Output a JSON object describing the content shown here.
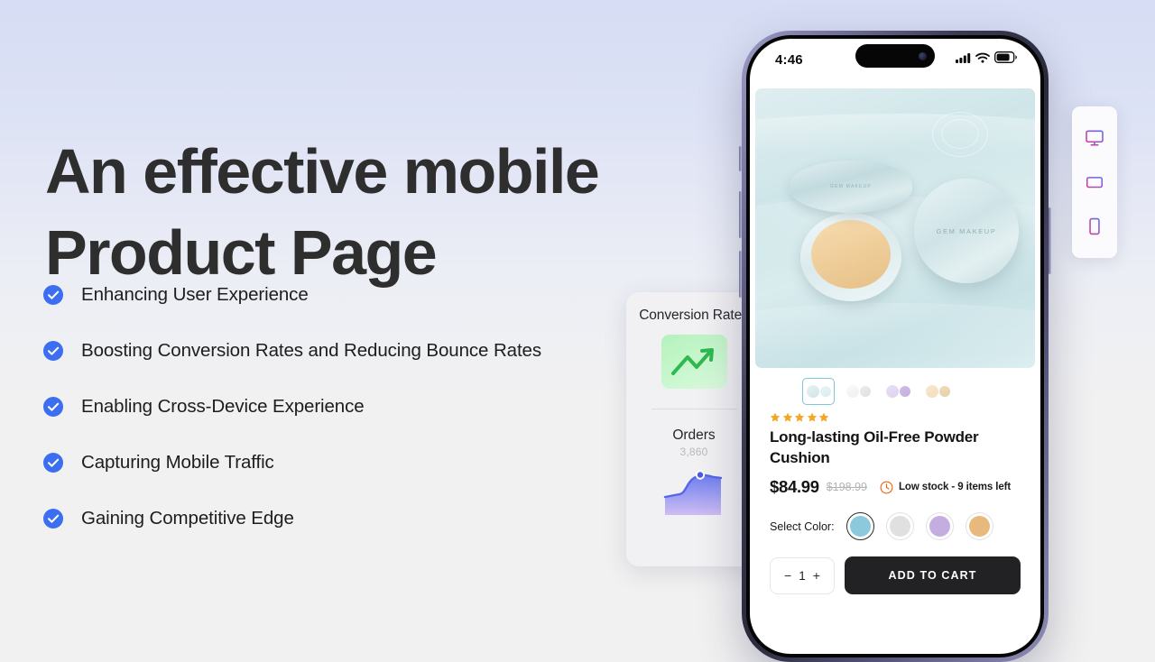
{
  "background": {
    "top_color": "#d6ddf4",
    "bottom_color": "#f1f1f1"
  },
  "hero": {
    "headline_line1": "An effective mobile",
    "headline_line2": "Product Page",
    "bullets": [
      {
        "label": "Enhancing User Experience"
      },
      {
        "label": "Boosting Conversion Rates and Reducing Bounce Rates"
      },
      {
        "label": "Enabling Cross-Device Experience"
      },
      {
        "label": "Capturing Mobile Traffic"
      },
      {
        "label": "Gaining Competitive Edge"
      }
    ],
    "check_icon": "check-circle-icon",
    "check_color": "#3b6ef0"
  },
  "analytics": {
    "conversion_title": "Conversion Rates",
    "conversion_icon": "trending-up-icon",
    "conversion_color": "#2fb94f",
    "orders_title": "Orders",
    "orders_value": "3,860",
    "orders_chart_color": "#6f7ff0"
  },
  "chart_data": [
    {
      "type": "line",
      "title": "Conversion Rates",
      "x": [
        0,
        1,
        2,
        3
      ],
      "values": [
        10,
        58,
        30,
        88
      ],
      "xlabel": "",
      "ylabel": "",
      "ylim": [
        0,
        100
      ],
      "grid": false,
      "legend": "none",
      "annotations": [
        "upward trending arrow"
      ]
    },
    {
      "type": "area",
      "title": "Orders",
      "value_label": "3,860",
      "x": [
        0,
        1,
        2,
        3,
        4,
        5,
        6,
        7
      ],
      "values": [
        30,
        34,
        36,
        38,
        56,
        74,
        78,
        70
      ],
      "xlabel": "",
      "ylabel": "",
      "ylim": [
        0,
        100
      ],
      "grid": false,
      "legend": "none",
      "marker_point": {
        "x": 6,
        "y": 78
      }
    }
  ],
  "phone": {
    "statusbar": {
      "time": "4:46",
      "signal_icon": "cellular-signal-icon",
      "wifi_icon": "wifi-icon",
      "battery_icon": "battery-icon"
    },
    "gallery": {
      "hero_alt": "GEM MAKEUP powder cushion compact on water",
      "lid_text": "GEM MAKEUP",
      "thumbnails": [
        {
          "name": "thumbnail-teal",
          "selected": true,
          "compact": "#cfe4e7",
          "lid": "#d8ecef"
        },
        {
          "name": "thumbnail-white",
          "selected": false,
          "compact": "#efefef",
          "lid": "#e0e0e0"
        },
        {
          "name": "thumbnail-lavender",
          "selected": false,
          "compact": "#ded2ef",
          "lid": "#c4aee0"
        },
        {
          "name": "thumbnail-tan",
          "selected": false,
          "compact": "#f2dcbc",
          "lid": "#e8cfa4"
        }
      ]
    },
    "product": {
      "rating_stars": 5,
      "star_color": "#f5a623",
      "title": "Long-lasting Oil-Free Powder Cushion",
      "price": "$84.99",
      "price_compare": "$198.99",
      "stock_icon": "clock-icon",
      "stock_color": "#f2600c",
      "stock_text": "Low stock - 9 items left",
      "color_label": "Select Color:",
      "colors": [
        {
          "name": "swatch-teal",
          "hex": "#8cc9dc",
          "selected": true
        },
        {
          "name": "swatch-white",
          "hex": "#e0e0e0",
          "selected": false
        },
        {
          "name": "swatch-lavender",
          "hex": "#c4aee0",
          "selected": false
        },
        {
          "name": "swatch-tan",
          "hex": "#e8b97d",
          "selected": false
        }
      ],
      "quantity": "1",
      "decrement_label": "−",
      "increment_label": "+",
      "add_to_cart_label": "ADD TO CART"
    }
  },
  "device_switcher": {
    "items": [
      {
        "name": "device-desktop",
        "icon": "desktop-icon"
      },
      {
        "name": "device-tablet",
        "icon": "tablet-icon"
      },
      {
        "name": "device-mobile",
        "icon": "mobile-icon"
      }
    ],
    "gradient_from": "#d6399b",
    "gradient_to": "#5b6ef0"
  }
}
